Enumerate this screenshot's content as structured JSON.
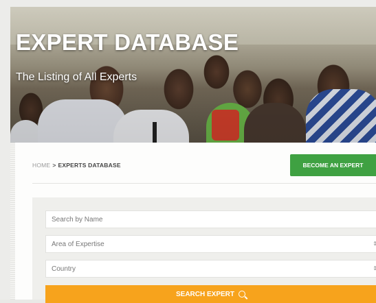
{
  "hero": {
    "title": "EXPERT DATABASE",
    "subtitle": "The Listing of All Experts"
  },
  "breadcrumb": {
    "home": "HOME",
    "separator": ">",
    "current": "EXPERTS DATABASE"
  },
  "actions": {
    "become_expert_label": "BECOME AN EXPERT"
  },
  "search": {
    "name_placeholder": "Search by Name",
    "area_placeholder": "Area of Expertise",
    "country_placeholder": "Country",
    "button_label": "SEARCH EXPERT",
    "button_icon": "search-icon"
  },
  "colors": {
    "green_button": "#3fa142",
    "orange_button": "#f7a31c"
  }
}
